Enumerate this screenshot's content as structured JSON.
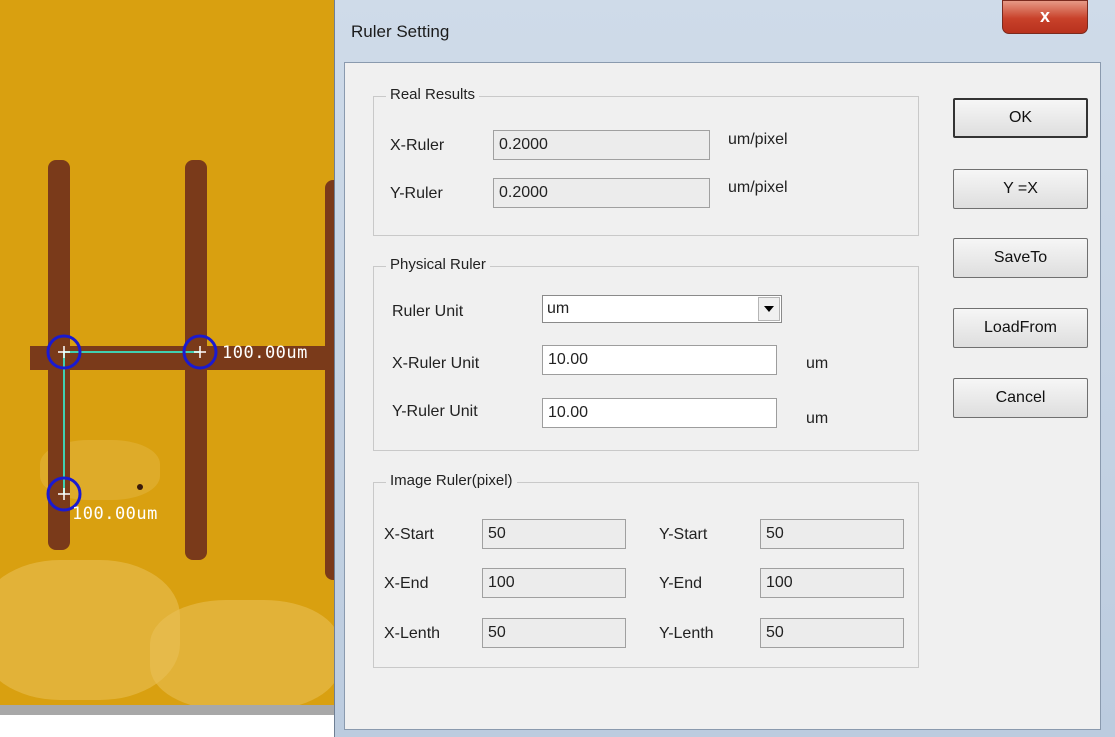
{
  "background": {
    "labels": {
      "horizontal": "100.00um",
      "vertical": "100.00um"
    }
  },
  "dialog": {
    "title": "Ruler Setting",
    "close_glyph": "x",
    "real_results": {
      "title": "Real Results",
      "x_label": "X-Ruler",
      "x_value": "0.2000",
      "x_unit": "um/pixel",
      "y_label": "Y-Ruler",
      "y_value": "0.2000",
      "y_unit": "um/pixel"
    },
    "physical_ruler": {
      "title": "Physical Ruler",
      "unit_label": "Ruler Unit",
      "unit_value": "um",
      "x_label": "X-Ruler Unit",
      "x_value": "10.00",
      "x_unit": "um",
      "y_label": "Y-Ruler Unit",
      "y_value": "10.00",
      "y_unit": "um"
    },
    "image_ruler": {
      "title": "Image Ruler(pixel)",
      "x_start_label": "X-Start",
      "x_start": "50",
      "y_start_label": "Y-Start",
      "y_start": "50",
      "x_end_label": "X-End",
      "x_end": "100",
      "y_end_label": "Y-End",
      "y_end": "100",
      "x_length_label": "X-Lenth",
      "x_length": "50",
      "y_length_label": "Y-Lenth",
      "y_length": "50"
    },
    "buttons": {
      "ok": "OK",
      "y_eq_x": "Y =X",
      "save_to": "SaveTo",
      "load_from": "LoadFrom",
      "cancel": "Cancel"
    }
  },
  "colors": {
    "background": "#d9a010",
    "trace": "#7a3a1a",
    "marker": "#1a1ad0",
    "guide": "#40d0b0",
    "close": "#c8412a"
  }
}
